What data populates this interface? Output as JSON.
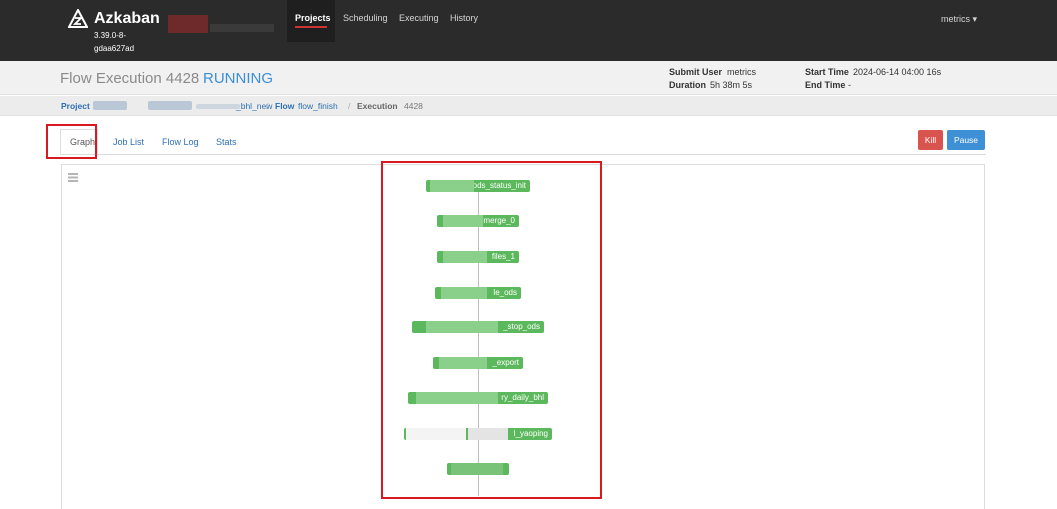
{
  "navbar": {
    "brand": "Azkaban",
    "version": "3.39.0-8-gdaa627ad",
    "version_line1": "3.39.0-8-",
    "version_line2": "gdaa627ad",
    "items": [
      {
        "label": "Projects",
        "active": true
      },
      {
        "label": "Scheduling",
        "active": false
      },
      {
        "label": "Executing",
        "active": false
      },
      {
        "label": "History",
        "active": false
      }
    ],
    "user": "metrics ▾"
  },
  "header": {
    "title": "Flow Execution 4428",
    "status": "RUNNING",
    "submit_user_label": "Submit User",
    "submit_user": "metrics",
    "duration_label": "Duration",
    "duration": "5h 38m 5s",
    "start_time_label": "Start Time",
    "start_time": "2024-06-14 04:00 16s",
    "end_time_label": "End Time",
    "end_time": "-"
  },
  "breadcrumb": {
    "project_label": "Project",
    "project_suffix": "_bhl_new",
    "flow_label": "Flow",
    "flow_name": "flow_finish",
    "execution_label": "Execution",
    "execution_id": "4428"
  },
  "tabs": [
    {
      "label": "Graph",
      "active": true
    },
    {
      "label": "Job List",
      "active": false
    },
    {
      "label": "Flow Log",
      "active": false
    },
    {
      "label": "Stats",
      "active": false
    }
  ],
  "actions": {
    "kill": "Kill",
    "pause": "Pause"
  },
  "graph": {
    "nodes": [
      {
        "label": "ods_status_init"
      },
      {
        "label": "merge_0"
      },
      {
        "label": "files_1"
      },
      {
        "label": "le_ods"
      },
      {
        "label": "_stop_ods"
      },
      {
        "label": "_export"
      },
      {
        "label": "ry_daily_bhl"
      },
      {
        "label": "l_yaoping"
      },
      {
        "label": ""
      }
    ]
  },
  "colors": {
    "navbar_bg": "#2b2b2b",
    "running": "#3a8fd6",
    "node_running": "#5cb85c",
    "kill": "#d9534f",
    "pause": "#3d8fd6",
    "highlight": "#d9181f"
  }
}
